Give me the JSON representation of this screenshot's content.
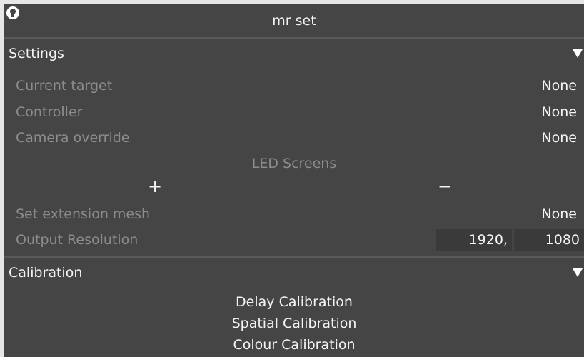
{
  "window": {
    "title": "mr set",
    "icon": "lightbulb-icon"
  },
  "settings": {
    "header": "Settings",
    "rows": [
      {
        "label": "Current target",
        "value": "None"
      },
      {
        "label": "Controller",
        "value": "None"
      },
      {
        "label": "Camera override",
        "value": "None"
      }
    ],
    "led_screens_label": "LED Screens",
    "add_symbol": "+",
    "remove_symbol": "−",
    "extension_mesh": {
      "label": "Set extension mesh",
      "value": "None"
    },
    "output_resolution": {
      "label": "Output Resolution",
      "width": "1920,",
      "height": "1080"
    }
  },
  "calibration": {
    "header": "Calibration",
    "items": [
      "Delay Calibration",
      "Spatial Calibration",
      "Colour Calibration"
    ]
  },
  "colors": {
    "panel_bg": "#454545",
    "outer_bg": "#e6e6e6",
    "label_gray": "#8c8c8c",
    "text_white": "#f4f4f4",
    "field_bg": "#3a3a3a"
  }
}
